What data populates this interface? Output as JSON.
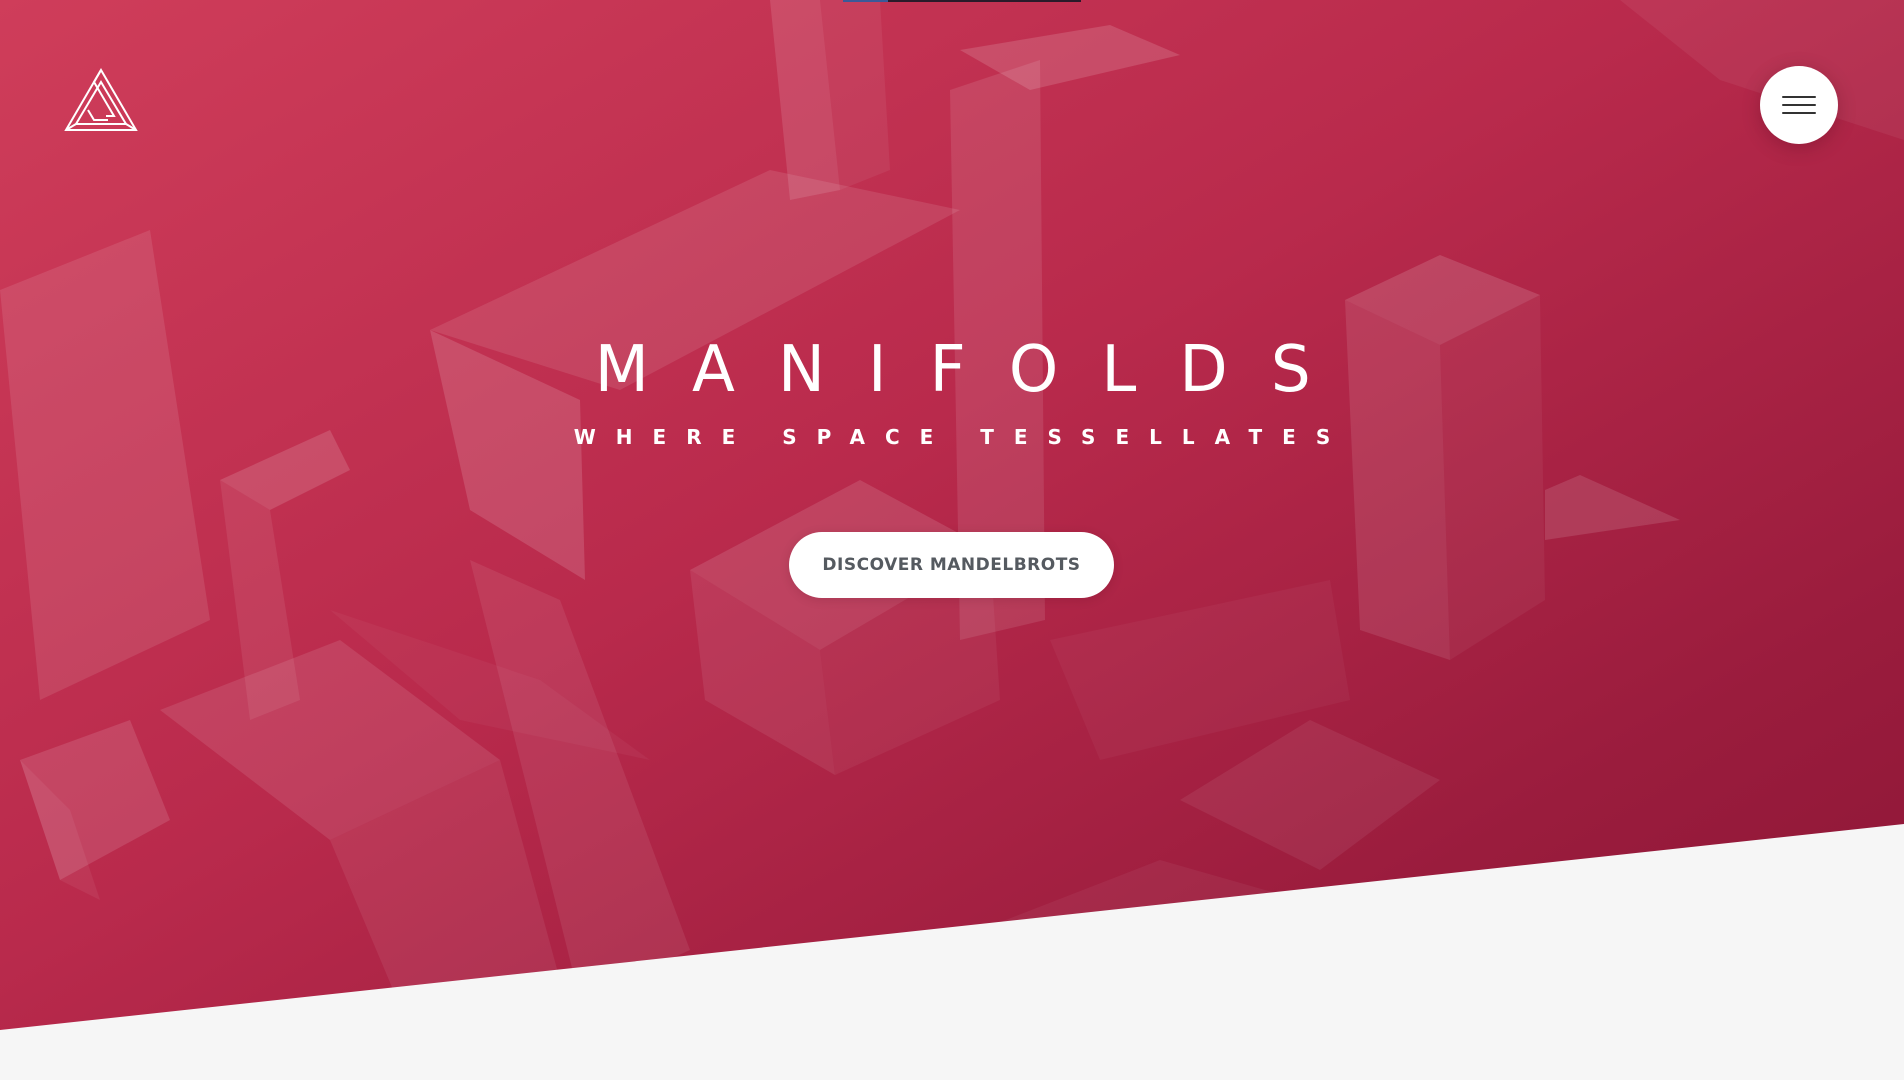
{
  "hero": {
    "title": "MANIFOLDS",
    "subtitle": "WHERE SPACE TESSELLATES",
    "cta_label": "DISCOVER MANDELBROTS"
  },
  "header": {
    "logo_icon": "impossible-triangle-icon",
    "menu_icon": "hamburger-menu-icon"
  },
  "colors": {
    "hero_start": "#cf3d5a",
    "hero_end": "#8d1636",
    "page_background": "#f6f6f6",
    "button_background": "#ffffff",
    "button_text": "#555a60"
  }
}
